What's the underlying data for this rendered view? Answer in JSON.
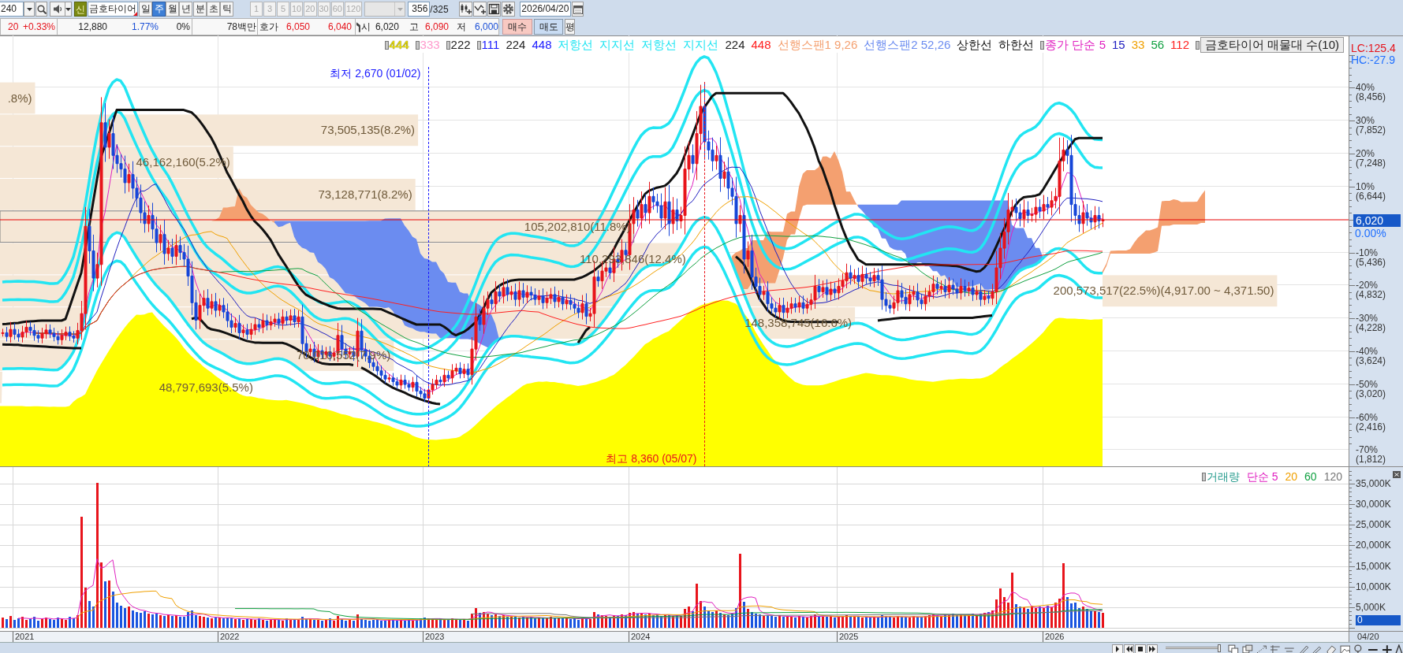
{
  "toolbar": {
    "period_count": "240",
    "stock_badge": "신",
    "stock_name": "금호타이어",
    "periods": [
      {
        "label": "일",
        "selected": false
      },
      {
        "label": "주",
        "selected": true
      },
      {
        "label": "월",
        "selected": false
      },
      {
        "label": "년",
        "selected": false
      },
      {
        "label": "분",
        "selected": false
      },
      {
        "label": "초",
        "selected": false
      },
      {
        "label": "틱",
        "selected": false
      }
    ],
    "intervals": [
      {
        "label": "1",
        "disabled": true
      },
      {
        "label": "3",
        "disabled": true
      },
      {
        "label": "5",
        "disabled": true
      },
      {
        "label": "10",
        "disabled": true
      },
      {
        "label": "20",
        "disabled": true
      },
      {
        "label": "30",
        "disabled": true
      },
      {
        "label": "60",
        "disabled": true
      },
      {
        "label": "120",
        "disabled": true
      }
    ],
    "interval_dropdown": {
      "disabled": true
    },
    "bar_count": "356",
    "bar_total": "/325",
    "date": "2026/04/20"
  },
  "quote_bar": {
    "change": "20",
    "change_rate": "+0.33%",
    "volume": "12,880",
    "turnover_rate": "1.77%",
    "ratio": "0%",
    "amount": "78백만",
    "ask_label": "호가",
    "ask": "6,050",
    "bid": "6,040",
    "open_label": "시",
    "open": "6,020",
    "high_label": "고",
    "high": "6,090",
    "low_label": "저",
    "low": "6,000",
    "buttons": [
      {
        "label": "매수",
        "kind": "buy"
      },
      {
        "label": "매도",
        "kind": "sell"
      },
      {
        "label": "평",
        "kind": "plain"
      }
    ]
  },
  "price_chart": {
    "legend": [
      {
        "text": "444",
        "color": "#f2e600",
        "marker": true
      },
      {
        "text": "333",
        "color": "#ff99cc",
        "marker": true
      },
      {
        "text": "222",
        "color": "#222222",
        "marker": true
      },
      {
        "text": "111",
        "color": "#1a1aff",
        "marker": true
      },
      {
        "text": "224",
        "color": "#222222"
      },
      {
        "text": "448",
        "color": "#1a1aff"
      },
      {
        "text": "저항선",
        "color": "#22e5f2"
      },
      {
        "text": "지지선",
        "color": "#22e5f2"
      },
      {
        "text": "저항선",
        "color": "#22e5f2"
      },
      {
        "text": "지지선",
        "color": "#22e5f2"
      },
      {
        "text": "224",
        "color": "#222222"
      },
      {
        "text": "448",
        "color": "#ff2020"
      },
      {
        "text": "선행스팬1 9,26",
        "color": "#f4a070"
      },
      {
        "text": "선행스팬2 52,26",
        "color": "#6b8cf0"
      },
      {
        "text": "상한선",
        "color": "#111111"
      },
      {
        "text": "하한선",
        "color": "#111111"
      },
      {
        "text": "종가 단순 5",
        "color": "#e020c0",
        "marker": true
      },
      {
        "text": "15",
        "color": "#2020c0"
      },
      {
        "text": "33",
        "color": "#f0a000"
      },
      {
        "text": "56",
        "color": "#10a040"
      },
      {
        "text": "112",
        "color": "#ff2020"
      },
      {
        "text": "금호타이어 매물대 수(10)",
        "kind": "box",
        "marker": true
      }
    ],
    "volume_profile": [
      {
        "label": ".8%)",
        "level": 0.026
      },
      {
        "label": "73,505,135(8.2%)",
        "level": 0.31
      },
      {
        "label": "46,162,160(5.2%)",
        "level": 0.173
      },
      {
        "label": "73,128,771(8.2%)",
        "level": 0.308
      },
      {
        "label": "105,202,810(11.8%)",
        "level": 0.47
      },
      {
        "label": "110,293,846(12.4%)",
        "level": 0.511
      },
      {
        "label": "200,573,517(22.5%)(4,917.00 ~ 4,371.50)",
        "level": 0.947
      },
      {
        "label": "148,358,745(16.6%)",
        "level": 0.634
      },
      {
        "label": "70,016,552(7.9%)",
        "level": 0.292
      },
      {
        "label": "48,797,693(5.5%)",
        "level": 0.19
      }
    ],
    "annotations": [
      "최저 2,670 (01/02)",
      "최고 8,360 (05/07)"
    ]
  },
  "price_axis": {
    "lc": "LC:125.4",
    "hc": "HC:-27.9",
    "ticks": [
      {
        "percent": "40%",
        "price": "(8,456)"
      },
      {
        "percent": "30%",
        "price": "(7,852)"
      },
      {
        "percent": "20%",
        "price": "(7,248)"
      },
      {
        "percent": "10%",
        "price": "(6,644)"
      },
      {
        "percent": "-10%",
        "price": "(5,436)"
      },
      {
        "percent": "-20%",
        "price": "(4,832)"
      },
      {
        "percent": "-30%",
        "price": "(4,228)"
      },
      {
        "percent": "-40%",
        "price": "(3,624)"
      },
      {
        "percent": "-50%",
        "price": "(3,020)"
      },
      {
        "percent": "-60%",
        "price": "(2,416)"
      },
      {
        "percent": "-70%",
        "price": "(1,812)"
      }
    ],
    "current_price": "6,020",
    "current_change": "0.00%"
  },
  "volume_chart": {
    "legend": [
      {
        "text": "거래량",
        "color": "#2a9d8f",
        "marker": true
      },
      {
        "text": "단순 5",
        "color": "#e020c0"
      },
      {
        "text": "20",
        "color": "#f0a000"
      },
      {
        "text": "60",
        "color": "#10a040"
      },
      {
        "text": "120",
        "color": "#777777"
      }
    ]
  },
  "volume_axis": {
    "ticks": [
      "35,000K",
      "30,000K",
      "25,000K",
      "20,000K",
      "15,000K",
      "10,000K",
      "5,000K"
    ],
    "current": "0"
  },
  "x_axis": {
    "years": [
      "2021",
      "2022",
      "2023",
      "2024",
      "2025",
      "2026"
    ],
    "end_date": "04/20"
  },
  "bottom_bar": {
    "slider": {
      "level": 1
    }
  }
}
